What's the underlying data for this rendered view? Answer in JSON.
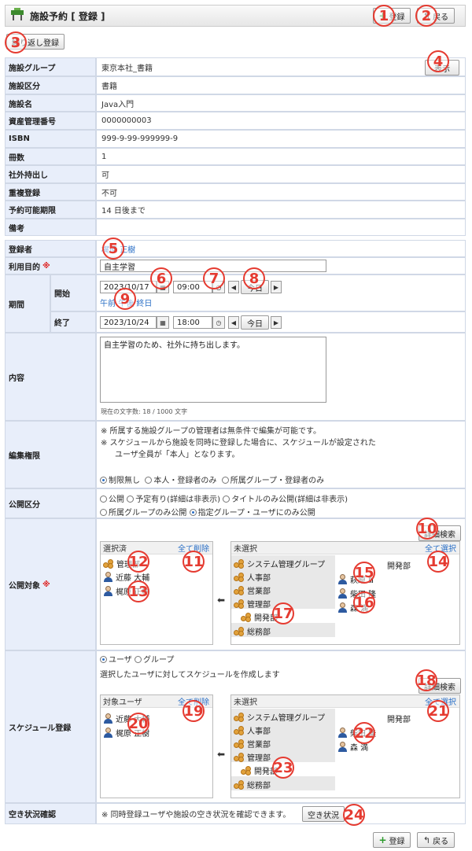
{
  "header": {
    "title": "施設予約",
    "mode": "[ 登録 ]",
    "register_label": "登録",
    "back_label": "戻る"
  },
  "repeat_label": "繰り返し登録",
  "display_label": "表示",
  "facility": {
    "rows": [
      {
        "label": "施設グループ",
        "value": "東京本社_書籍"
      },
      {
        "label": "施設区分",
        "value": "書籍"
      },
      {
        "label": "施設名",
        "value": "Java入門"
      },
      {
        "label": "資産管理番号",
        "value": "0000000003"
      },
      {
        "label": "ISBN",
        "value": "999-9-99-999999-9"
      },
      {
        "label": "冊数",
        "value": "1"
      },
      {
        "label": "社外持出し",
        "value": "可"
      },
      {
        "label": "重複登録",
        "value": "不可"
      },
      {
        "label": "予約可能期限",
        "value": "14 日後まで"
      },
      {
        "label": "備考",
        "value": ""
      }
    ]
  },
  "form": {
    "registrant_label": "登録者",
    "registrant": "梶原 正樹",
    "purpose_label": "利用目的",
    "required_mark": "※",
    "purpose": "自主学習",
    "period_label": "期間",
    "start_label": "開始",
    "end_label": "終了",
    "start_date": "2023/10/17",
    "start_time": "09:00",
    "end_date": "2023/10/24",
    "end_time": "18:00",
    "today_label": "今日",
    "am": "午前",
    "pm": "午後",
    "allday": "終日",
    "content_label": "内容",
    "content": "自主学習のため、社外に持ち出します。",
    "char_count": "現在の文字数: 18 / 1000 文字",
    "edit_label": "編集権限",
    "edit_note1": "※ 所属する施設グループの管理者は無条件で編集が可能です。",
    "edit_note2": "※ スケジュールから施設を同時に登録した場合に、スケジュールが設定された",
    "edit_note3": "ユーザ全員が「本人」となります。",
    "edit_opts": [
      "制限無し",
      "本人・登録者のみ",
      "所属グループ・登録者のみ"
    ],
    "pub_label": "公開区分",
    "pub_opts1": [
      "公開",
      "予定有り(詳細は非表示)",
      "タイトルのみ公開(詳細は非表示)"
    ],
    "pub_opts2": [
      "所属グループのみ公開",
      "指定グループ・ユーザにのみ公開"
    ],
    "target_label": "公開対象",
    "detail_search": "詳細検索",
    "selected_label": "選択済",
    "delete_all": "全て削除",
    "unselected_label": "未選択",
    "select_all": "全て選択",
    "pub_selected": [
      "管理部",
      "近藤 大輔",
      "梶原 正樹"
    ],
    "groups": [
      "システム管理グループ",
      "人事部",
      "営業部",
      "管理部",
      "開発部",
      "総務部"
    ],
    "dev_label": "開発部",
    "pub_users": [
      "萩原 Ⅲ",
      "柴田 隆",
      "森 満"
    ],
    "sched_label": "スケジュール登録",
    "sched_opts": [
      "ユーザ",
      "グループ"
    ],
    "sched_note": "選択したユーザに対してスケジュールを作成します",
    "target_user_label": "対象ユーザ",
    "sched_selected": [
      "近藤 大輔",
      "梶原 正樹"
    ],
    "sched_users": [
      "柴田 隆",
      "森 満"
    ],
    "avail_label": "空き状況確認",
    "avail_note": "※ 同時登録ユーザや施設の空き状況を確認できます。",
    "avail_btn": "空き状況"
  },
  "badges": [
    "1",
    "2",
    "3",
    "4",
    "5",
    "6",
    "7",
    "8",
    "9",
    "10",
    "11",
    "12",
    "13",
    "14",
    "15",
    "16",
    "17",
    "18",
    "19",
    "20",
    "21",
    "22",
    "23",
    "24"
  ],
  "colors": {
    "label_bg": "#e8eefa",
    "link": "#2a6fc6",
    "badge": "#e53a30",
    "required": "#dd2222"
  }
}
